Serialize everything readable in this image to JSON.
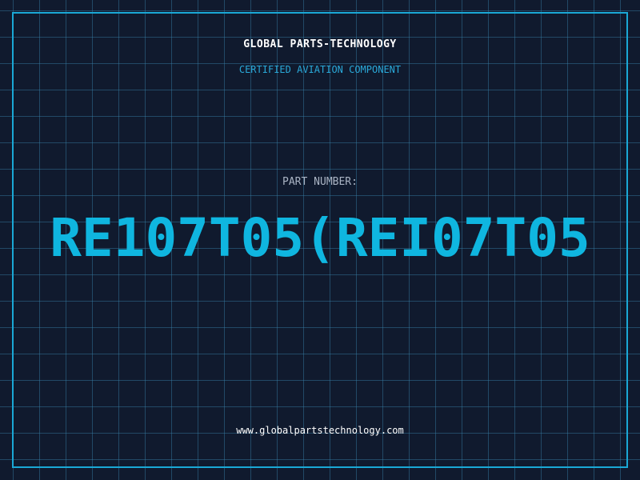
{
  "header": {
    "company": "GLOBAL PARTS-TECHNOLOGY",
    "tagline": "CERTIFIED AVIATION COMPONENT"
  },
  "main": {
    "label": "PART NUMBER:",
    "part_number": "RE107T05(REI07T05"
  },
  "footer": {
    "url": "www.globalpartstechnology.com"
  },
  "colors": {
    "background": "#101a2e",
    "grid": "#3882aa",
    "accent": "#0fb6e0",
    "label": "#aab4c4"
  }
}
